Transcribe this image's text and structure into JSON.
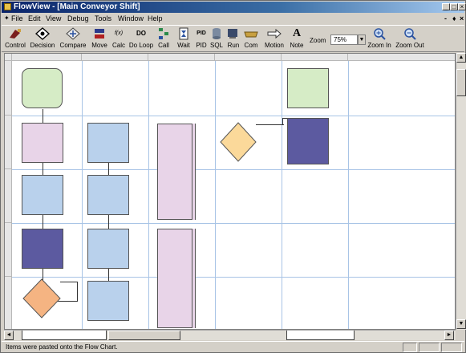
{
  "window": {
    "title": "FlowView - [Main Conveyor Shift]"
  },
  "menu": {
    "items": [
      "File",
      "Edit",
      "View",
      "Debug",
      "Tools",
      "Window",
      "Help"
    ]
  },
  "toolbar": {
    "buttons": [
      {
        "label": "Control",
        "icon": "control-icon"
      },
      {
        "label": "Decision",
        "icon": "decision-icon"
      },
      {
        "label": "Compare",
        "icon": "compare-icon"
      },
      {
        "label": "Move",
        "icon": "move-icon"
      },
      {
        "label": "Calc",
        "icon": "calc-icon"
      },
      {
        "label": "Do Loop",
        "icon": "do-loop-icon"
      },
      {
        "label": "Call",
        "icon": "call-icon"
      },
      {
        "label": "Wait",
        "icon": "wait-icon"
      },
      {
        "label": "PID",
        "icon": "pid-icon"
      },
      {
        "label": "SQL",
        "icon": "sql-icon"
      },
      {
        "label": "Run",
        "icon": "run-icon"
      },
      {
        "label": "Com",
        "icon": "com-icon"
      },
      {
        "label": "Motion",
        "icon": "motion-icon"
      },
      {
        "label": "Note",
        "icon": "note-icon"
      }
    ],
    "calc_icon_text": "f(x)",
    "do_loop_icon_text": "DO",
    "pid_icon_text": "PID",
    "note_icon_text": "A",
    "zoom_label": "Zoom",
    "zoom_value": "75%",
    "zoom_in_label": "Zoom In",
    "zoom_out_label": "Zoom Out"
  },
  "statusbar": {
    "message": "Items were pasted onto the Flow Chart."
  },
  "colors": {
    "title_gradient_start": "#0a246a",
    "grid_line": "#a8c4e6",
    "start_block_fill": "#d6ecc6",
    "action_block_fill": "#b9d1ec",
    "complex_block_fill": "#e8d4e8",
    "decision_fill": "#fbd99a",
    "decision_fill_alt": "#f5b482",
    "subroutine_fill": "#5c5aa0"
  }
}
